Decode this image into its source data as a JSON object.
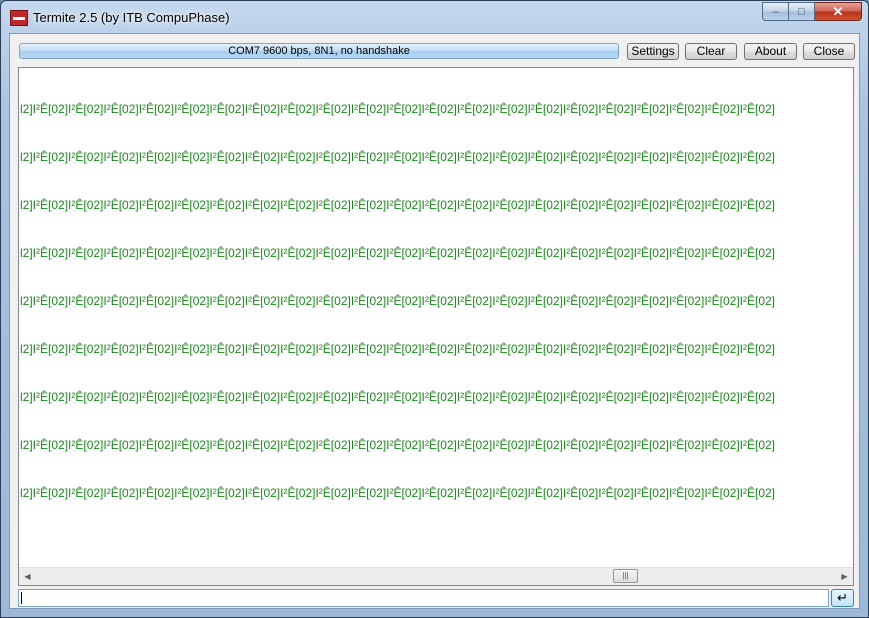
{
  "window": {
    "title": "Termite 2.5 (by ITB CompuPhase)"
  },
  "caption_buttons": {
    "minimize": "–",
    "maximize": "□",
    "close": "✕"
  },
  "toolbar": {
    "status": "COM7 9600 bps, 8N1, no handshake",
    "settings_label": "Settings",
    "clear_label": "Clear",
    "about_label": "About",
    "close_label": "Close"
  },
  "output": {
    "text_color": "#1a8a1a",
    "lines": [
      "l2]I²Ê[02]I²Ê[02]I²Ê[02]I²Ê[02]I²Ê[02]I²Ê[02]I²Ê[02]I²Ê[02]I²Ê[02]I²Ê[02]I²Ê[02]I²Ê[02]I²Ê[02]I²Ê[02]I²Ê[02]I²Ê[02]I²Ê[02]I²Ê[02]I²Ê[02]I²Ê[02]I²Ê[02]",
      "l2]I²Ê[02]I²Ê[02]I²Ê[02]I²Ê[02]I²Ê[02]I²Ê[02]I²Ê[02]I²Ê[02]I²Ê[02]I²Ê[02]I²Ê[02]I²Ê[02]I²Ê[02]I²Ê[02]I²Ê[02]I²Ê[02]I²Ê[02]I²Ê[02]I²Ê[02]I²Ê[02]I²Ê[02]",
      "l2]I²Ê[02]I²Ê[02]I²Ê[02]I²Ê[02]I²Ê[02]I²Ê[02]I²Ê[02]I²Ê[02]I²Ê[02]I²Ê[02]I²Ê[02]I²Ê[02]I²Ê[02]I²Ê[02]I²Ê[02]I²Ê[02]I²Ê[02]I²Ê[02]I²Ê[02]I²Ê[02]I²Ê[02]",
      "l2]I²Ê[02]I²Ê[02]I²Ê[02]I²Ê[02]I²Ê[02]I²Ê[02]I²Ê[02]I²Ê[02]I²Ê[02]I²Ê[02]I²Ê[02]I²Ê[02]I²Ê[02]I²Ê[02]I²Ê[02]I²Ê[02]I²Ê[02]I²Ê[02]I²Ê[02]I²Ê[02]I²Ê[02]",
      "l2]I²Ê[02]I²Ê[02]I²Ê[02]I²Ê[02]I²Ê[02]I²Ê[02]I²Ê[02]I²Ê[02]I²Ê[02]I²Ê[02]I²Ê[02]I²Ê[02]I²Ê[02]I²Ê[02]I²Ê[02]I²Ê[02]I²Ê[02]I²Ê[02]I²Ê[02]I²Ê[02]I²Ê[02]",
      "l2]I²Ê[02]I²Ê[02]I²Ê[02]I²Ê[02]I²Ê[02]I²Ê[02]I²Ê[02]I²Ê[02]I²Ê[02]I²Ê[02]I²Ê[02]I²Ê[02]I²Ê[02]I²Ê[02]I²Ê[02]I²Ê[02]I²Ê[02]I²Ê[02]I²Ê[02]I²Ê[02]I²Ê[02]",
      "l2]I²Ê[02]I²Ê[02]I²Ê[02]I²Ê[02]I²Ê[02]I²Ê[02]I²Ê[02]I²Ê[02]I²Ê[02]I²Ê[02]I²Ê[02]I²Ê[02]I²Ê[02]I²Ê[02]I²Ê[02]I²Ê[02]I²Ê[02]I²Ê[02]I²Ê[02]I²Ê[02]I²Ê[02]",
      "l2]I²Ê[02]I²Ê[02]I²Ê[02]I²Ê[02]I²Ê[02]I²Ê[02]I²Ê[02]I²Ê[02]I²Ê[02]I²Ê[02]I²Ê[02]I²Ê[02]I²Ê[02]I²Ê[02]I²Ê[02]I²Ê[02]I²Ê[02]I²Ê[02]I²Ê[02]I²Ê[02]I²Ê[02]",
      "l2]I²Ê[02]I²Ê[02]I²Ê[02]I²Ê[02]I²Ê[02]I²Ê[02]I²Ê[02]I²Ê[02]I²Ê[02]I²Ê[02]I²Ê[02]I²Ê[02]I²Ê[02]I²Ê[02]I²Ê[02]I²Ê[02]I²Ê[02]I²Ê[02]I²Ê[02]I²Ê[02]I²Ê[02]"
    ]
  },
  "scrollbar": {
    "left_arrow": "◀",
    "right_arrow": "▶",
    "thumb_grip": "|||"
  },
  "input": {
    "value": "",
    "send_label": "↵"
  }
}
